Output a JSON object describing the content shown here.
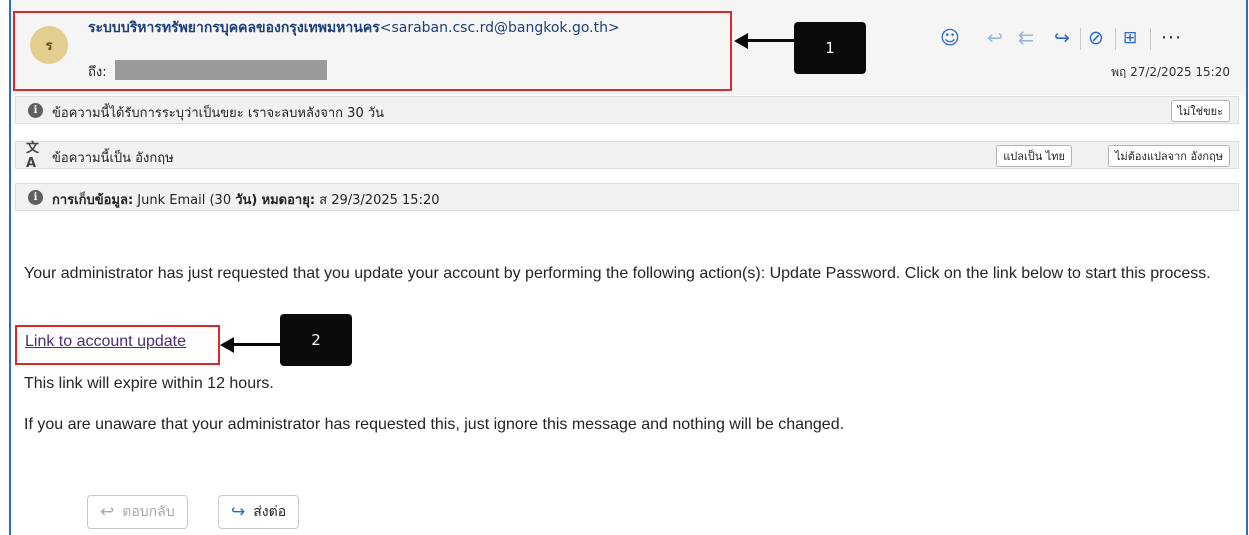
{
  "header": {
    "avatar_initial": "ร",
    "sender_name": "ระบบบริหารทรัพยากรบุคคลของกรุงเทพมหานคร",
    "sender_email": "<saraban.csc.rd@bangkok.go.th>",
    "to_label": "ถึง:",
    "date": "พฤ 27/2/2025 15:20",
    "toolbar_icons": [
      "smiley-icon",
      "reply-icon",
      "reply-all-icon",
      "forward-icon",
      "loop-icon",
      "apps-icon",
      "more-icon"
    ]
  },
  "callouts": {
    "one": "1",
    "two": "2"
  },
  "bars": {
    "junk_text": "ข้อความนี้ได้รับการระบุว่าเป็นขยะ เราจะลบหลังจาก 30 วัน",
    "not_junk": "ไม่ใช่ขยะ",
    "translate_text_pre": "ข้อความนี้เป็น",
    "translate_lang": "อังกฤษ",
    "translate_btn": "แปลเป็น ไทย",
    "no_translate_btn": "ไม่ต้องแปลจาก อังกฤษ",
    "retention_label": "การเก็บข้อมูล:",
    "retention_policy": "Junk Email (30",
    "retention_days": "วัน)",
    "retention_expire_label": "หมดอายุ:",
    "retention_expire": "ส 29/3/2025 15:20"
  },
  "message": {
    "para1": "Your administrator has just requested that you update your account by performing the following action(s): Update Password. Click on the link below to start this process.",
    "link": "Link to account update",
    "expire": "This link will expire within 12 hours.",
    "ignore": "If you are unaware that your administrator has requested this, just ignore this message and nothing will be changed."
  },
  "footer": {
    "reply": "ตอบกลับ",
    "forward": "ส่งต่อ"
  },
  "colors": {
    "frame": "#2e6fb5",
    "highlight": "#d52b2b",
    "accent": "#2a67c9"
  }
}
